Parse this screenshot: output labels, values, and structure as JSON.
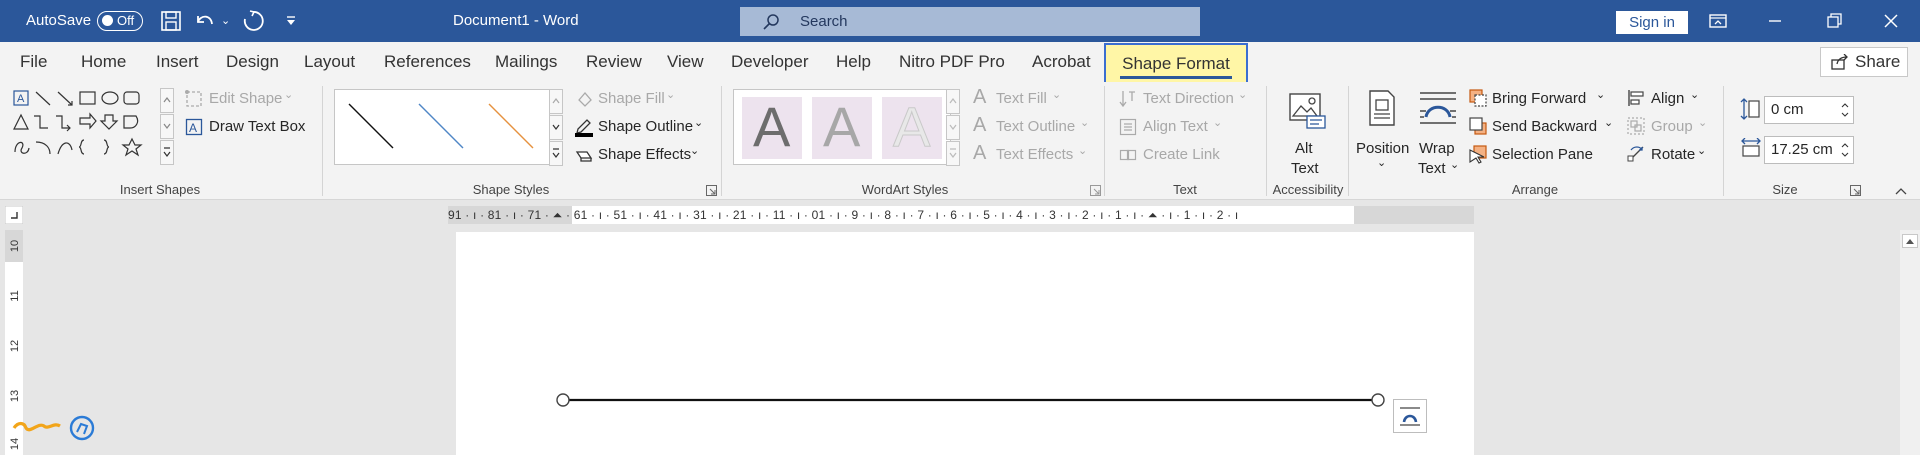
{
  "titlebar": {
    "autosave_label": "AutoSave",
    "autosave_state": "Off",
    "document_title": "Document1  -  Word",
    "search_placeholder": "Search",
    "signin_label": "Sign in"
  },
  "tabs": [
    "File",
    "Home",
    "Insert",
    "Design",
    "Layout",
    "References",
    "Mailings",
    "Review",
    "View",
    "Developer",
    "Help",
    "Nitro PDF Pro",
    "Acrobat"
  ],
  "active_tab": "Shape Format",
  "share_label": "Share",
  "ribbon": {
    "insert_shapes": {
      "label": "Insert Shapes",
      "edit_shape": "Edit Shape",
      "draw_text_box": "Draw Text Box"
    },
    "shape_styles": {
      "label": "Shape Styles",
      "shape_fill": "Shape Fill",
      "shape_outline": "Shape Outline",
      "shape_effects": "Shape Effects"
    },
    "wordart_styles": {
      "label": "WordArt Styles",
      "text_fill": "Text Fill",
      "text_outline": "Text Outline",
      "text_effects": "Text Effects",
      "sample": "A"
    },
    "text": {
      "label": "Text",
      "text_direction": "Text Direction",
      "align_text": "Align Text",
      "create_link": "Create Link"
    },
    "accessibility": {
      "label": "Accessibility",
      "alt_text_1": "Alt",
      "alt_text_2": "Text"
    },
    "arrange": {
      "label": "Arrange",
      "position": "Position",
      "wrap_1": "Wrap",
      "wrap_2": "Text",
      "bring_forward": "Bring Forward",
      "send_backward": "Send Backward",
      "selection_pane": "Selection Pane",
      "align": "Align",
      "group": "Group",
      "rotate": "Rotate"
    },
    "size": {
      "label": "Size",
      "height": "0 cm",
      "width": "17.25 cm"
    }
  },
  "ruler": {
    "horizontal": "91 · ı · 81 · ı · 71 · ⏶ · 61 · ı · 51 · ı · 41 · ı · 31 · ı · 21 · ı · 11 · ı · 01 · ı · 9 · ı · 8 · ı · 7 · ı · 6 · ı · 5 · ı · 4 · ı · 3 · ı · 2 · ı · 1 · ı · ⏶ · ı · 1 · ı · 2 · ı",
    "vertical": [
      "10",
      "11",
      "12",
      "13",
      "14"
    ]
  },
  "colors": {
    "title_bar": "#2b579a",
    "active_tab_highlight": "#fff6a6",
    "active_tab_border": "#3b6ed0"
  }
}
